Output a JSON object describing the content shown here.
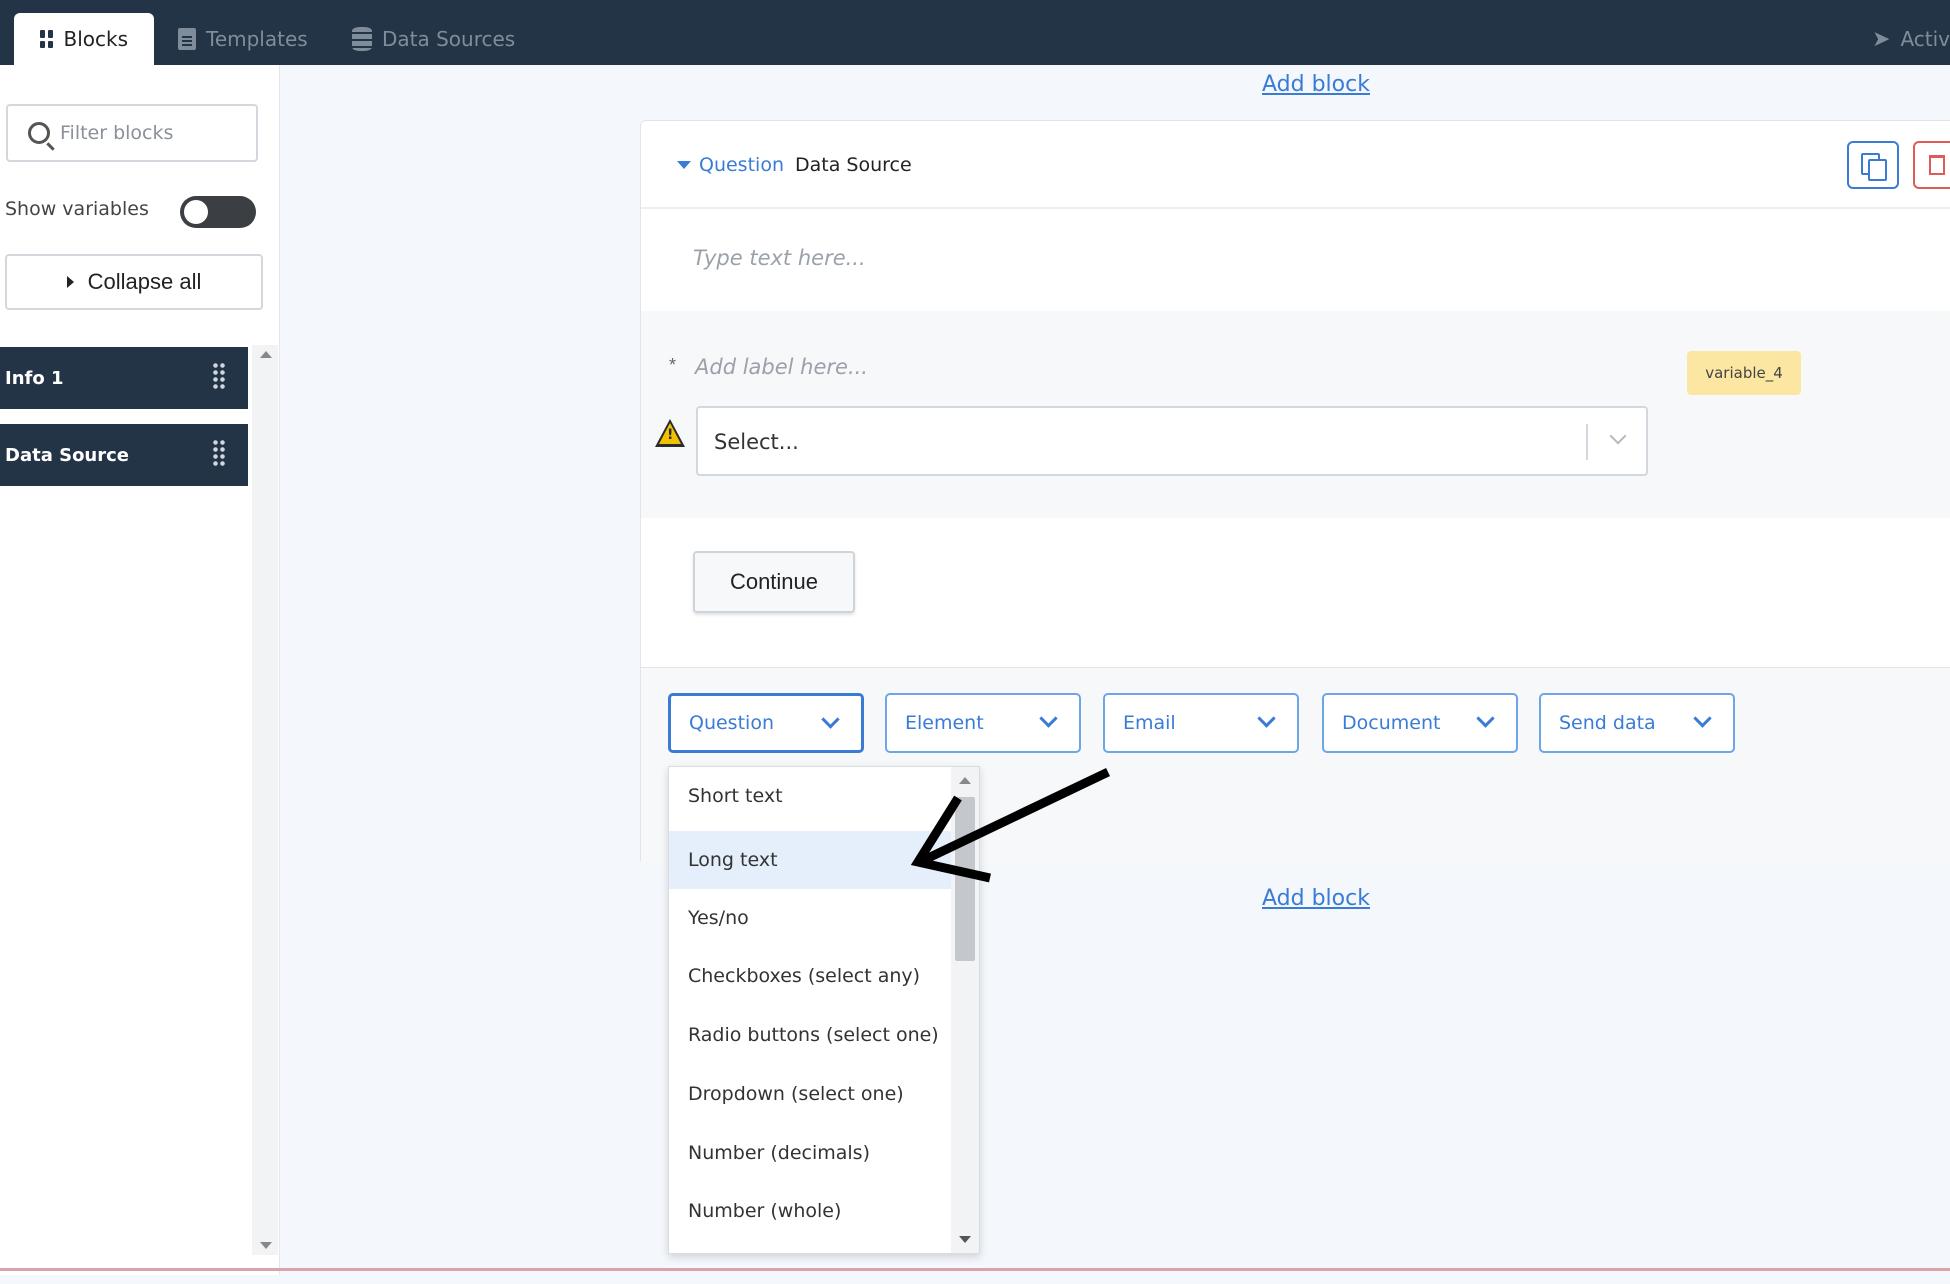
{
  "tabs": {
    "blocks": "Blocks",
    "templates": "Templates",
    "data_sources": "Data Sources",
    "activate": "Activ"
  },
  "sidebar": {
    "filter_placeholder": "Filter blocks",
    "show_variables_label": "Show variables",
    "show_variables_on": false,
    "collapse_all": "Collapse all",
    "blocks": [
      {
        "label": "Info 1"
      },
      {
        "label": "Data Source"
      }
    ]
  },
  "main": {
    "add_block_top": "Add block",
    "add_block_bottom": "Add block",
    "card": {
      "type_label": "Question",
      "title": "Data Source",
      "text_placeholder": "Type text here...",
      "required_marker": "*",
      "label_placeholder": "Add label here...",
      "variable": "variable_4",
      "select_placeholder": "Select...",
      "continue": "Continue"
    },
    "add_menu": {
      "question": "Question",
      "element": "Element",
      "email": "Email",
      "document": "Document",
      "send_data": "Send data"
    },
    "question_options": [
      "Short text",
      "Long text",
      "Yes/no",
      "Checkboxes (select any)",
      "Radio buttons (select one)",
      "Dropdown (select one)",
      "Number (decimals)",
      "Number (whole)"
    ],
    "highlighted_option": "Long text"
  },
  "colors": {
    "topbar": "#243447",
    "accent": "#3a7bd5",
    "variable_badge": "#fbe7a1",
    "highlight": "#e5eefb"
  }
}
